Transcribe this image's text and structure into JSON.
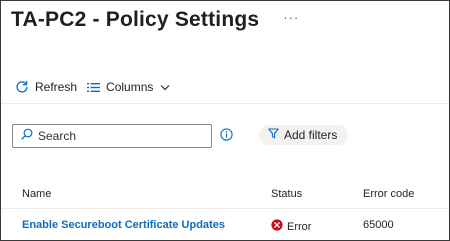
{
  "page": {
    "title": "TA-PC2 - Policy Settings",
    "more_label": "···"
  },
  "toolbar": {
    "refresh_label": "Refresh",
    "columns_label": "Columns"
  },
  "search": {
    "placeholder": "Search",
    "value": ""
  },
  "filters": {
    "add_filters_label": "Add filters"
  },
  "table": {
    "columns": [
      "Name",
      "Status",
      "Error code"
    ],
    "rows": [
      {
        "name": "Enable Secureboot Certificate Updates",
        "status": "Error",
        "error_code": "65000"
      }
    ]
  },
  "colors": {
    "link": "#0f6cbd",
    "error": "#c50f1f",
    "accent": "#0f6cbd"
  },
  "icons": {
    "refresh": "refresh-icon",
    "columns": "columns-icon",
    "chevron": "chevron-down-icon",
    "search": "search-icon",
    "info": "info-icon",
    "filter": "filter-icon",
    "error": "error-icon"
  }
}
